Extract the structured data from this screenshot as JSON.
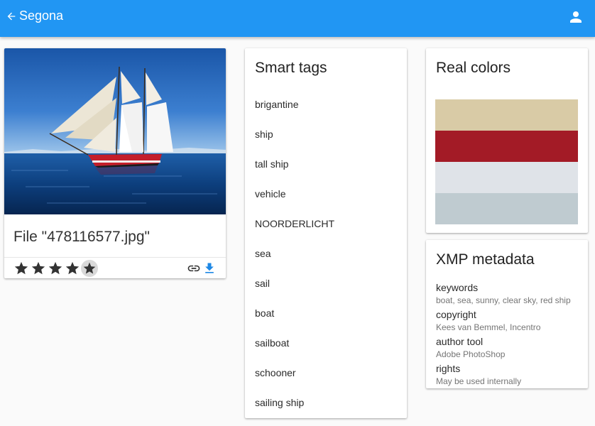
{
  "app": {
    "title": "Segona",
    "back_icon": "arrow-left-icon",
    "account_icon": "account-icon"
  },
  "photo": {
    "file_title": "File \"478116577.jpg\"",
    "rating": 4,
    "max_rating": 5,
    "link_icon": "link-icon",
    "download_icon": "download-icon"
  },
  "tags": {
    "title": "Smart tags",
    "items": [
      "brigantine",
      "ship",
      "tall ship",
      "vehicle",
      "NOORDERLICHT",
      "sea",
      "sail",
      "boat",
      "sailboat",
      "schooner",
      "sailing ship"
    ]
  },
  "colors": {
    "title": "Real colors",
    "swatches": [
      "#d9cba6",
      "#a31b26",
      "#dfe3e8",
      "#bfcbd0"
    ]
  },
  "xmp": {
    "title": "XMP metadata",
    "fields": [
      {
        "key": "keywords",
        "value": "boat, sea, sunny, clear sky, red ship"
      },
      {
        "key": "copyright",
        "value": "Kees van Bemmel, Incentro"
      },
      {
        "key": "author tool",
        "value": "Adobe PhotoShop"
      },
      {
        "key": "rights",
        "value": "May be used internally"
      }
    ]
  },
  "theme": {
    "primary": "#2196f3",
    "download": "#1e88e5"
  }
}
